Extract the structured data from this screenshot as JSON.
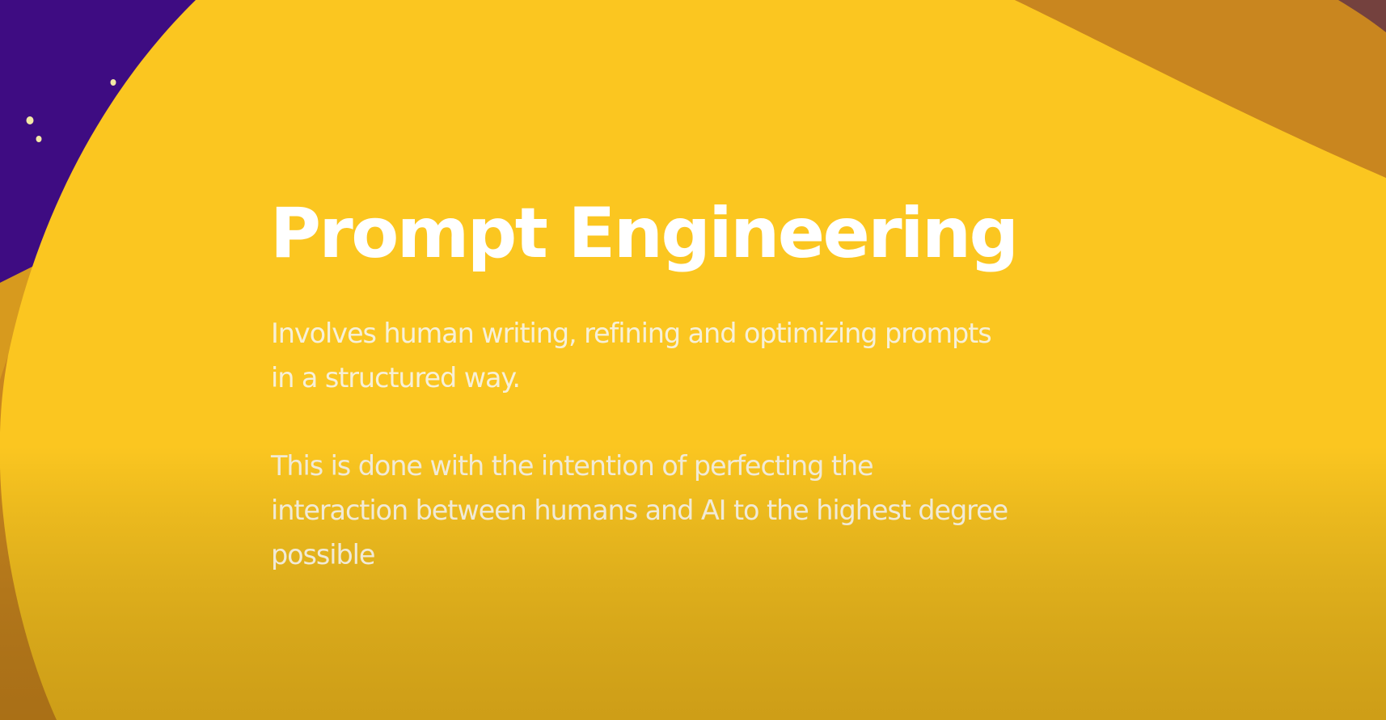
{
  "slide": {
    "title": "Prompt Engineering",
    "paragraph_1": "Involves human writing, refining and optimizing prompts\nin a structured way.",
    "paragraph_2": "This is done with the intention of perfecting the\ninteraction between humans and AI to the highest degree\npossible"
  },
  "colors": {
    "background_yellow": "#fbc620",
    "background_purple": "#3e0c82",
    "background_orange": "#c9861f",
    "text_white": "#ffffff",
    "dots": "#f3e9a6"
  }
}
